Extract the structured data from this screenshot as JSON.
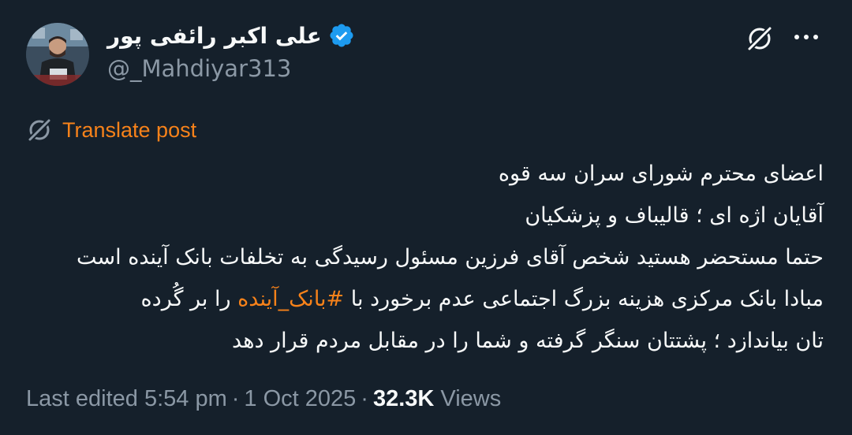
{
  "author": {
    "name": "علی اکبر رائفی پور",
    "handle": "@_Mahdiyar313",
    "verified": true
  },
  "actions": {
    "grok_icon": "grok-icon",
    "more_icon": "more-icon"
  },
  "translate": {
    "label": "Translate post",
    "color": "#f7821a"
  },
  "post": {
    "line1": "اعضای محترم شورای سران سه قوه",
    "line2": "آقایان اژه ای ؛ قالیباف و پزشکیان",
    "line3": "حتما مستحضر  هستید شخص آقای فرزین مسئول رسیدگی به تخلفات بانک آینده است",
    "line4_before": "مبادا بانک مرکزی هزینه بزرگ اجتماعی عدم برخورد با ",
    "hashtag": "#بانک_آینده",
    "line4_after": " را بر گُرده",
    "line5": "تان بیاندازد ؛ پشتتان سنگر گرفته و شما را در مقابل مردم قرار دهد"
  },
  "meta": {
    "edited": "Last edited 5:54 pm",
    "date": "1 Oct 2025",
    "views_count": "32.3K",
    "views_label": "Views",
    "separator": "·"
  },
  "colors": {
    "background": "#15202b",
    "accent": "#f7821a",
    "secondary_text": "#8b98a5",
    "verified": "#1d9bf0"
  }
}
